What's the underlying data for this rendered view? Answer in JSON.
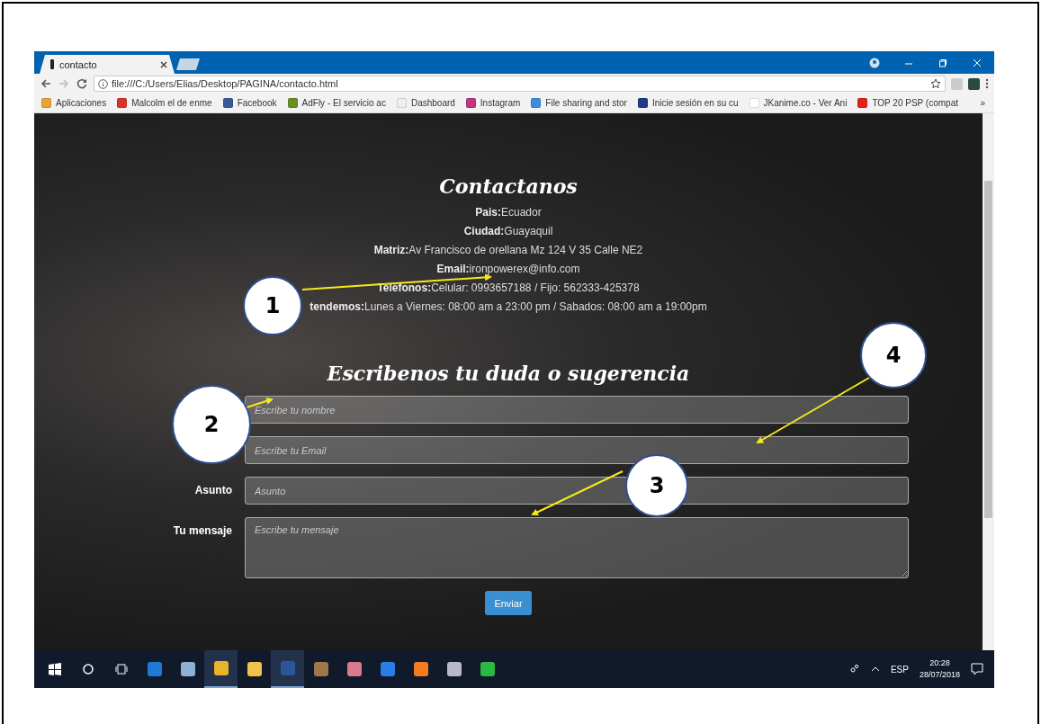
{
  "browser": {
    "tab": {
      "title": "contacto",
      "selected": true
    },
    "address": "file:///C:/Users/Elias/Desktop/PAGINA/contacto.html",
    "bookmarks": [
      {
        "label": "Aplicaciones",
        "color": "#e8a33a"
      },
      {
        "label": "Malcolm el de enme",
        "color": "#d9342b"
      },
      {
        "label": "Facebook",
        "color": "#3b5998"
      },
      {
        "label": "AdFly - El servicio ac",
        "color": "#6b8e23"
      },
      {
        "label": "Dashboard",
        "color": "#eeeeee"
      },
      {
        "label": "Instagram",
        "color": "#c13584"
      },
      {
        "label": "File sharing and stor",
        "color": "#3d8ee0"
      },
      {
        "label": "Inicie sesión en su cu",
        "color": "#1f3b8a"
      },
      {
        "label": "JKanime.co - Ver Ani",
        "color": "#ffffff"
      },
      {
        "label": "TOP 20 PSP (compat",
        "color": "#e62117"
      }
    ],
    "overflow": "»"
  },
  "page": {
    "heading": "Contactanos",
    "info": [
      {
        "label": "Pais:",
        "value": "Ecuador"
      },
      {
        "label": "Ciudad:",
        "value": "Guayaquil"
      },
      {
        "label": "Matriz:",
        "value": "Av Francisco de orellana Mz 124 V 35 Calle NE2"
      },
      {
        "label": "Email:",
        "value": "ironpowerex@info.com"
      },
      {
        "label": "Telefonos:",
        "value": "Celular: 0993657188 / Fijo: 562333-425378"
      },
      {
        "label": "tendemos:",
        "value": "Lunes a Viernes: 08:00 am a 23:00 pm / Sabados: 08:00 am a 19:00pm"
      }
    ],
    "form_heading": "Escribenos tu duda o sugerencia",
    "fields": [
      {
        "kind": "input",
        "placeholder": "Escribe tu nombre"
      },
      {
        "kind": "input",
        "placeholder": "Escribe tu Email"
      },
      {
        "kind": "input",
        "label": "Asunto",
        "placeholder": "Asunto"
      },
      {
        "kind": "textarea",
        "label": "Tu mensaje",
        "placeholder": "Escribe tu mensaje"
      }
    ],
    "submit": "Enviar"
  },
  "taskbar": {
    "apps": [
      {
        "kind": "start",
        "running": false
      },
      {
        "kind": "search",
        "running": false
      },
      {
        "kind": "taskview",
        "running": false
      },
      {
        "kind": "app",
        "color": "#1e7ad6",
        "running": false
      },
      {
        "kind": "app",
        "color": "#8fb0d0",
        "running": false
      },
      {
        "kind": "app",
        "color": "#e9b32a",
        "running": true
      },
      {
        "kind": "app",
        "color": "#f2c34a",
        "running": false
      },
      {
        "kind": "app",
        "color": "#2b579a",
        "running": true
      },
      {
        "kind": "app",
        "color": "#a0764a",
        "running": false
      },
      {
        "kind": "app",
        "color": "#d87a8a",
        "running": false
      },
      {
        "kind": "app",
        "color": "#2b7de9",
        "running": false
      },
      {
        "kind": "app",
        "color": "#f47b20",
        "running": false
      },
      {
        "kind": "app",
        "color": "#b8b8c8",
        "running": false
      },
      {
        "kind": "app",
        "color": "#2bb741",
        "running": false
      }
    ],
    "language": "ESP",
    "time": "20:28",
    "date": "28/07/2018"
  },
  "annotations": [
    {
      "number": "1"
    },
    {
      "number": "2"
    },
    {
      "number": "3"
    },
    {
      "number": "4"
    }
  ]
}
